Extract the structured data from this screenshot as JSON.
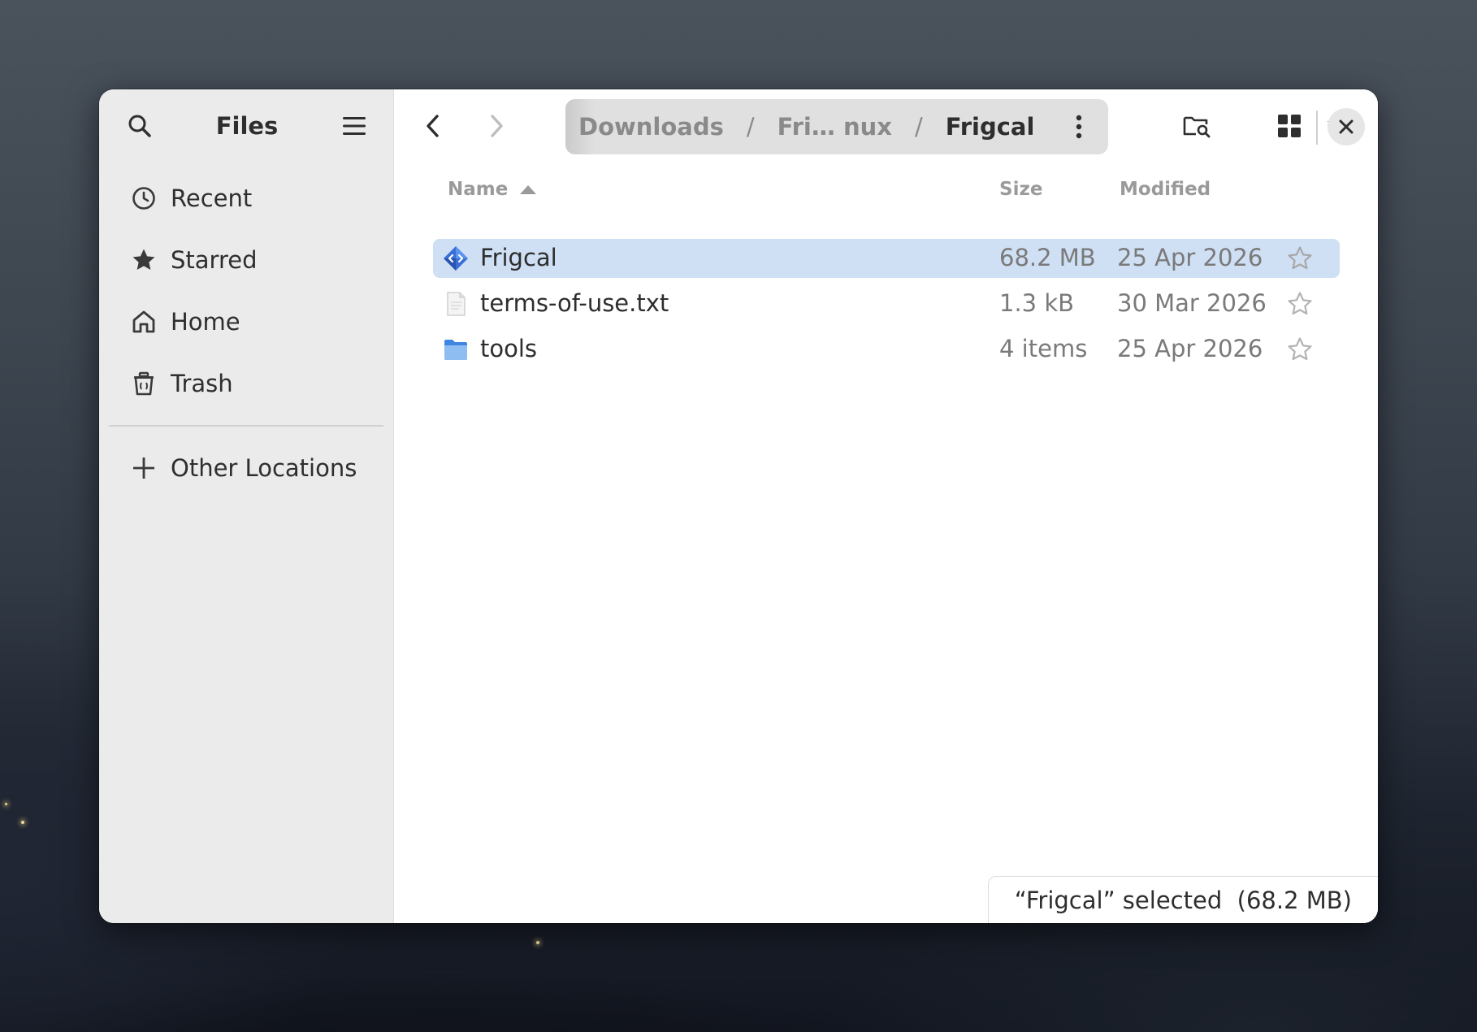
{
  "sidebar": {
    "title": "Files",
    "items": [
      {
        "label": "Recent",
        "icon": "clock-icon"
      },
      {
        "label": "Starred",
        "icon": "star-icon"
      },
      {
        "label": "Home",
        "icon": "home-icon"
      },
      {
        "label": "Trash",
        "icon": "trash-icon"
      }
    ],
    "other_locations": "Other Locations"
  },
  "toolbar": {
    "breadcrumb": [
      "Downloads",
      "Fri… nux",
      "Frigcal"
    ],
    "separator": "/"
  },
  "columns": {
    "name": "Name",
    "size": "Size",
    "modified": "Modified"
  },
  "files": [
    {
      "name": "Frigcal",
      "size": "68.2 MB",
      "modified": "25 Apr 2026",
      "type": "executable",
      "selected": true
    },
    {
      "name": "terms-of-use.txt",
      "size": "1.3 kB",
      "modified": "30 Mar 2026",
      "type": "text",
      "selected": false
    },
    {
      "name": "tools",
      "size": "4 items",
      "modified": "25 Apr 2026",
      "type": "folder",
      "selected": false
    }
  ],
  "status": {
    "text": "“Frigcal” selected  (68.2 MB)"
  },
  "colors": {
    "selection": "#cfdff4",
    "folder": "#5a9ce8",
    "accent": "#3584e4"
  }
}
